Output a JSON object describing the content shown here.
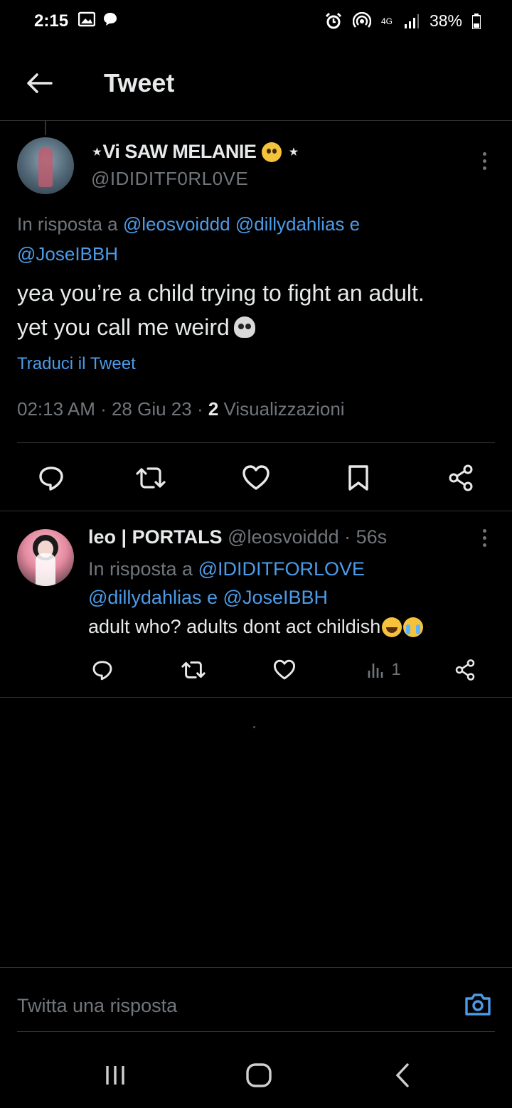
{
  "status_bar": {
    "time": "2:15",
    "battery": "38%",
    "network": "4G"
  },
  "header": {
    "title": "Tweet"
  },
  "main_tweet": {
    "display_name": "⋆Vi SAW MELANIE",
    "display_name_suffix": "⋆",
    "handle": "@IDIDITF0RL0VE",
    "reply_prefix": "In risposta a",
    "reply_to": [
      "@leosvoiddd",
      "@dillydahlias",
      "@JoseIBBH"
    ],
    "reply_joiner": "e",
    "text_line1": "yea you’re a child trying to fight an adult.",
    "text_line2": "yet you call me weird",
    "translate": "Traduci il Tweet",
    "time": "02:13 AM",
    "date": "28 Giu 23",
    "views_count": "2",
    "views_label": "Visualizzazioni"
  },
  "reply_tweet": {
    "display_name": "leo | PORTALS",
    "handle": "@leosvoiddd",
    "age": "56s",
    "reply_prefix": "In risposta a",
    "reply_to": [
      "@IDIDITFORLOVE",
      "@dillydahlias",
      "@JoseIBBH"
    ],
    "reply_joiner": "e",
    "text": "adult who? adults dont act childish",
    "views_count": "1"
  },
  "compose": {
    "placeholder": "Twitta una risposta"
  },
  "colors": {
    "background": "#000000",
    "text": "#e7e9ea",
    "muted": "#71767b",
    "link": "#4c9be8",
    "divider": "#2f3336"
  },
  "icons": [
    "back-arrow-icon",
    "more-icon",
    "reply-icon",
    "retweet-icon",
    "like-icon",
    "bookmark-icon",
    "share-icon",
    "views-icon",
    "camera-icon",
    "nav-recents-icon",
    "nav-home-icon",
    "nav-back-icon"
  ]
}
